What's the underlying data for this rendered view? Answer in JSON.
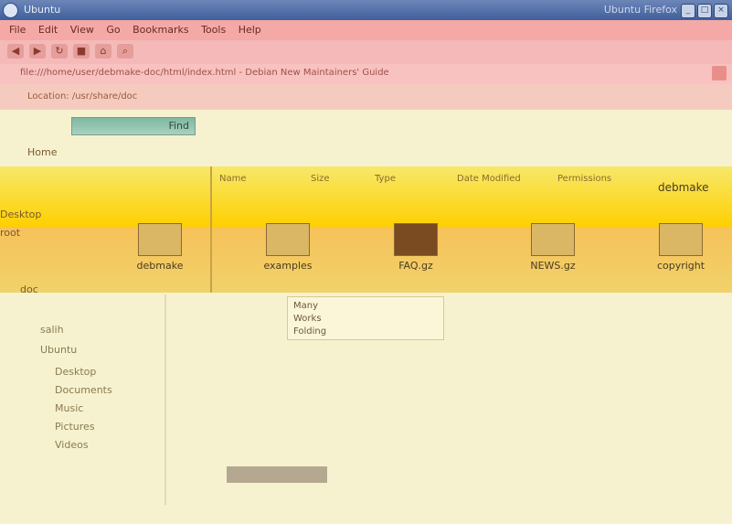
{
  "window": {
    "title": "Ubuntu",
    "right_text": "Ubuntu Firefox",
    "controls": [
      "_",
      "□",
      "×"
    ]
  },
  "menubar": {
    "items": [
      "File",
      "Edit",
      "View",
      "Go",
      "Bookmarks",
      "Tools",
      "Help"
    ]
  },
  "toolbar": {
    "buttons": [
      {
        "name": "back",
        "glyph": "◀"
      },
      {
        "name": "forward",
        "glyph": "▶"
      },
      {
        "name": "reload",
        "glyph": "↻"
      },
      {
        "name": "stop",
        "glyph": "■"
      },
      {
        "name": "home",
        "glyph": "⌂"
      },
      {
        "name": "search",
        "glyph": "⌕"
      }
    ]
  },
  "address": {
    "location": "file:///home/user/debmake-doc/html/index.html - Debian New Maintainers' Guide"
  },
  "path": {
    "text": "Location: /usr/share/doc"
  },
  "sidebar": {
    "tab_label": "Find",
    "items": [
      {
        "label": "Home"
      },
      {
        "label": "Desktop"
      },
      {
        "label": "root"
      },
      {
        "label": "doc"
      }
    ]
  },
  "column_headers": [
    "Name",
    "Size",
    "Type",
    "Date Modified",
    "Permissions",
    "debmake"
  ],
  "files": [
    {
      "label": "debmake",
      "icon": "folder-icon"
    },
    {
      "label": "examples",
      "icon": "file-icon"
    },
    {
      "label": "FAQ.gz",
      "icon": "archive-icon"
    },
    {
      "label": "NEWS.gz",
      "icon": "archive-icon"
    },
    {
      "label": "copyright",
      "icon": "text-file-icon"
    }
  ],
  "tree": {
    "items": [
      "salih",
      "Ubuntu",
      "Desktop",
      "Documents",
      "Music",
      "Pictures",
      "Videos"
    ]
  },
  "popup": {
    "lines": [
      "Many",
      "Works",
      "Folding"
    ]
  },
  "colors": {
    "titlebar": "#3f5f9c",
    "menubar": "#f4a9a6",
    "band_top": "#ffd000",
    "band_bottom": "#f6c15a",
    "background": "#f6f2cf"
  }
}
